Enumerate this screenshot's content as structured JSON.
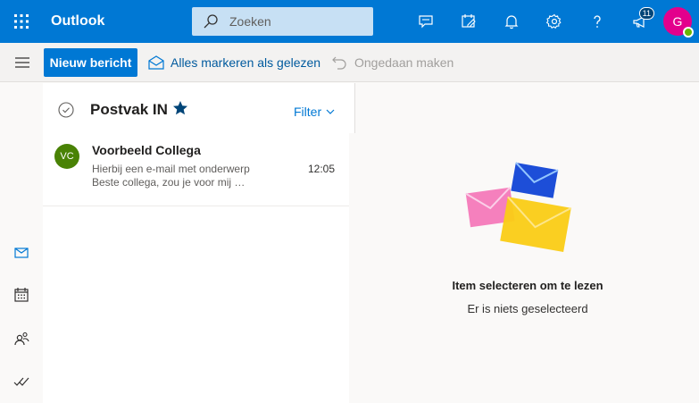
{
  "header": {
    "app_title": "Outlook",
    "search_placeholder": "Zoeken",
    "notification_badge": "11",
    "avatar_initial": "G"
  },
  "commands": {
    "new_message": "Nieuw bericht",
    "mark_all_read": "Alles markeren als gelezen",
    "undo": "Ongedaan maken"
  },
  "message_list": {
    "folder_name": "Postvak IN",
    "filter_label": "Filter",
    "messages": [
      {
        "initials": "VC",
        "sender": "Voorbeeld Collega",
        "subject": "Hierbij een e-mail met onderwerp",
        "preview": "Beste collega, zou je voor mij …",
        "time": "12:05"
      }
    ]
  },
  "reading_pane": {
    "title": "Item selecteren om te lezen",
    "subtitle": "Er is niets geselecteerd"
  },
  "icons": [
    "waffle-icon",
    "search-icon",
    "chat-icon",
    "todo-icon",
    "bell-icon",
    "settings-icon",
    "help-icon",
    "megaphone-icon",
    "hamburger-icon",
    "envelope-open-icon",
    "undo-icon",
    "mail-icon",
    "calendar-icon",
    "people-icon",
    "tasks-icon",
    "check-circle-icon",
    "star-icon",
    "chevron-down-icon"
  ],
  "colors": {
    "brand": "#0078d4",
    "avatar": "#e3008c",
    "contact_avatar": "#498205",
    "presence": "#6bb700"
  }
}
